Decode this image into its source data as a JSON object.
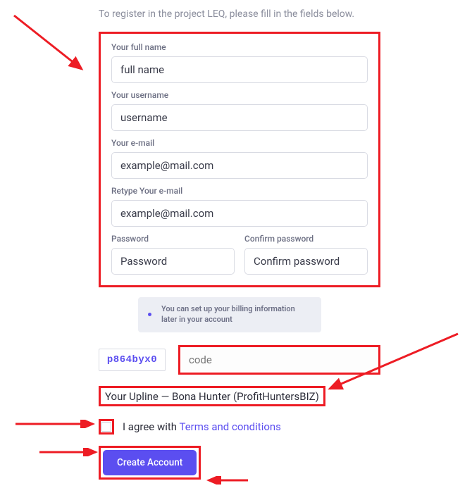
{
  "intro": "To register in the project LEQ, please fill in the fields below.",
  "fields": {
    "fullname": {
      "label": "Your full name",
      "placeholder": "full name"
    },
    "username": {
      "label": "Your username",
      "placeholder": "username"
    },
    "email": {
      "label": "Your e-mail",
      "placeholder": "example@mail.com"
    },
    "email_retype": {
      "label": "Retype Your e-mail",
      "placeholder": "example@mail.com"
    },
    "password": {
      "label": "Password",
      "placeholder": "Password"
    },
    "password_confirm": {
      "label": "Confirm password",
      "placeholder": "Confirm password"
    }
  },
  "billing_tip": "You can set up your billing information later in your account",
  "captcha": {
    "display": "p864byx0",
    "placeholder": "code"
  },
  "upline": "Your Upline — Bona Hunter (ProfitHuntersBIZ)",
  "agree": {
    "prefix": "I agree with ",
    "link": "Terms and conditions"
  },
  "submit_label": "Create Account",
  "colors": {
    "accent": "#5b4ef0",
    "highlight": "#ed1c24"
  }
}
